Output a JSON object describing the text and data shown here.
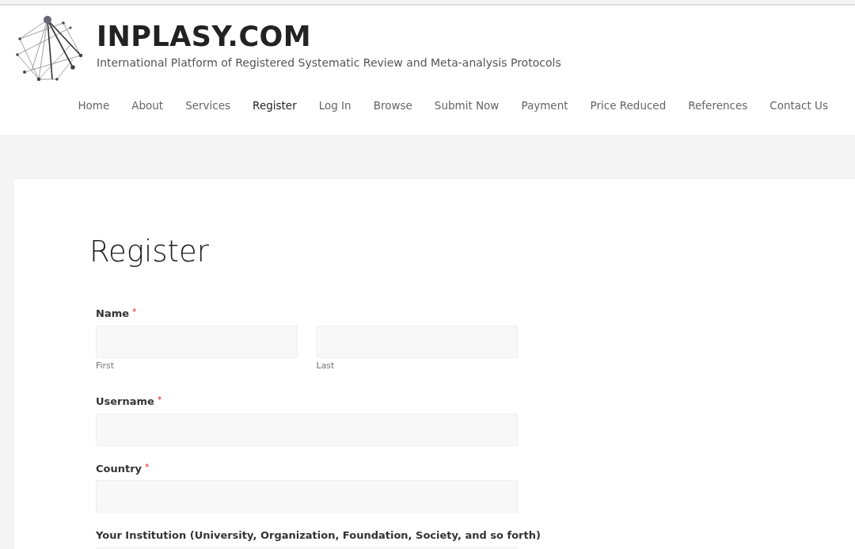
{
  "site": {
    "title": "INPLASY.COM",
    "tagline": "International Platform of Registered Systematic Review and Meta-analysis Protocols"
  },
  "nav": [
    {
      "label": "Home",
      "selected": false
    },
    {
      "label": "About",
      "selected": false
    },
    {
      "label": "Services",
      "selected": false
    },
    {
      "label": "Register",
      "selected": true
    },
    {
      "label": "Log In",
      "selected": false
    },
    {
      "label": "Browse",
      "selected": false
    },
    {
      "label": "Submit Now",
      "selected": false
    },
    {
      "label": "Payment",
      "selected": false
    },
    {
      "label": "Price Reduced",
      "selected": false
    },
    {
      "label": "References",
      "selected": false
    },
    {
      "label": "Contact Us",
      "selected": false
    }
  ],
  "page_title": "Register",
  "fields": [
    {
      "kind": "split",
      "label": "Name",
      "required_mark": "*",
      "sublabels": [
        "First",
        "Last"
      ]
    },
    {
      "kind": "text",
      "label": "Username",
      "required_mark": "*"
    },
    {
      "kind": "text",
      "label": "Country",
      "required_mark": "*"
    },
    {
      "kind": "text",
      "label": "Your Institution (University, Organization, Foundation, Society, and so forth)"
    }
  ]
}
